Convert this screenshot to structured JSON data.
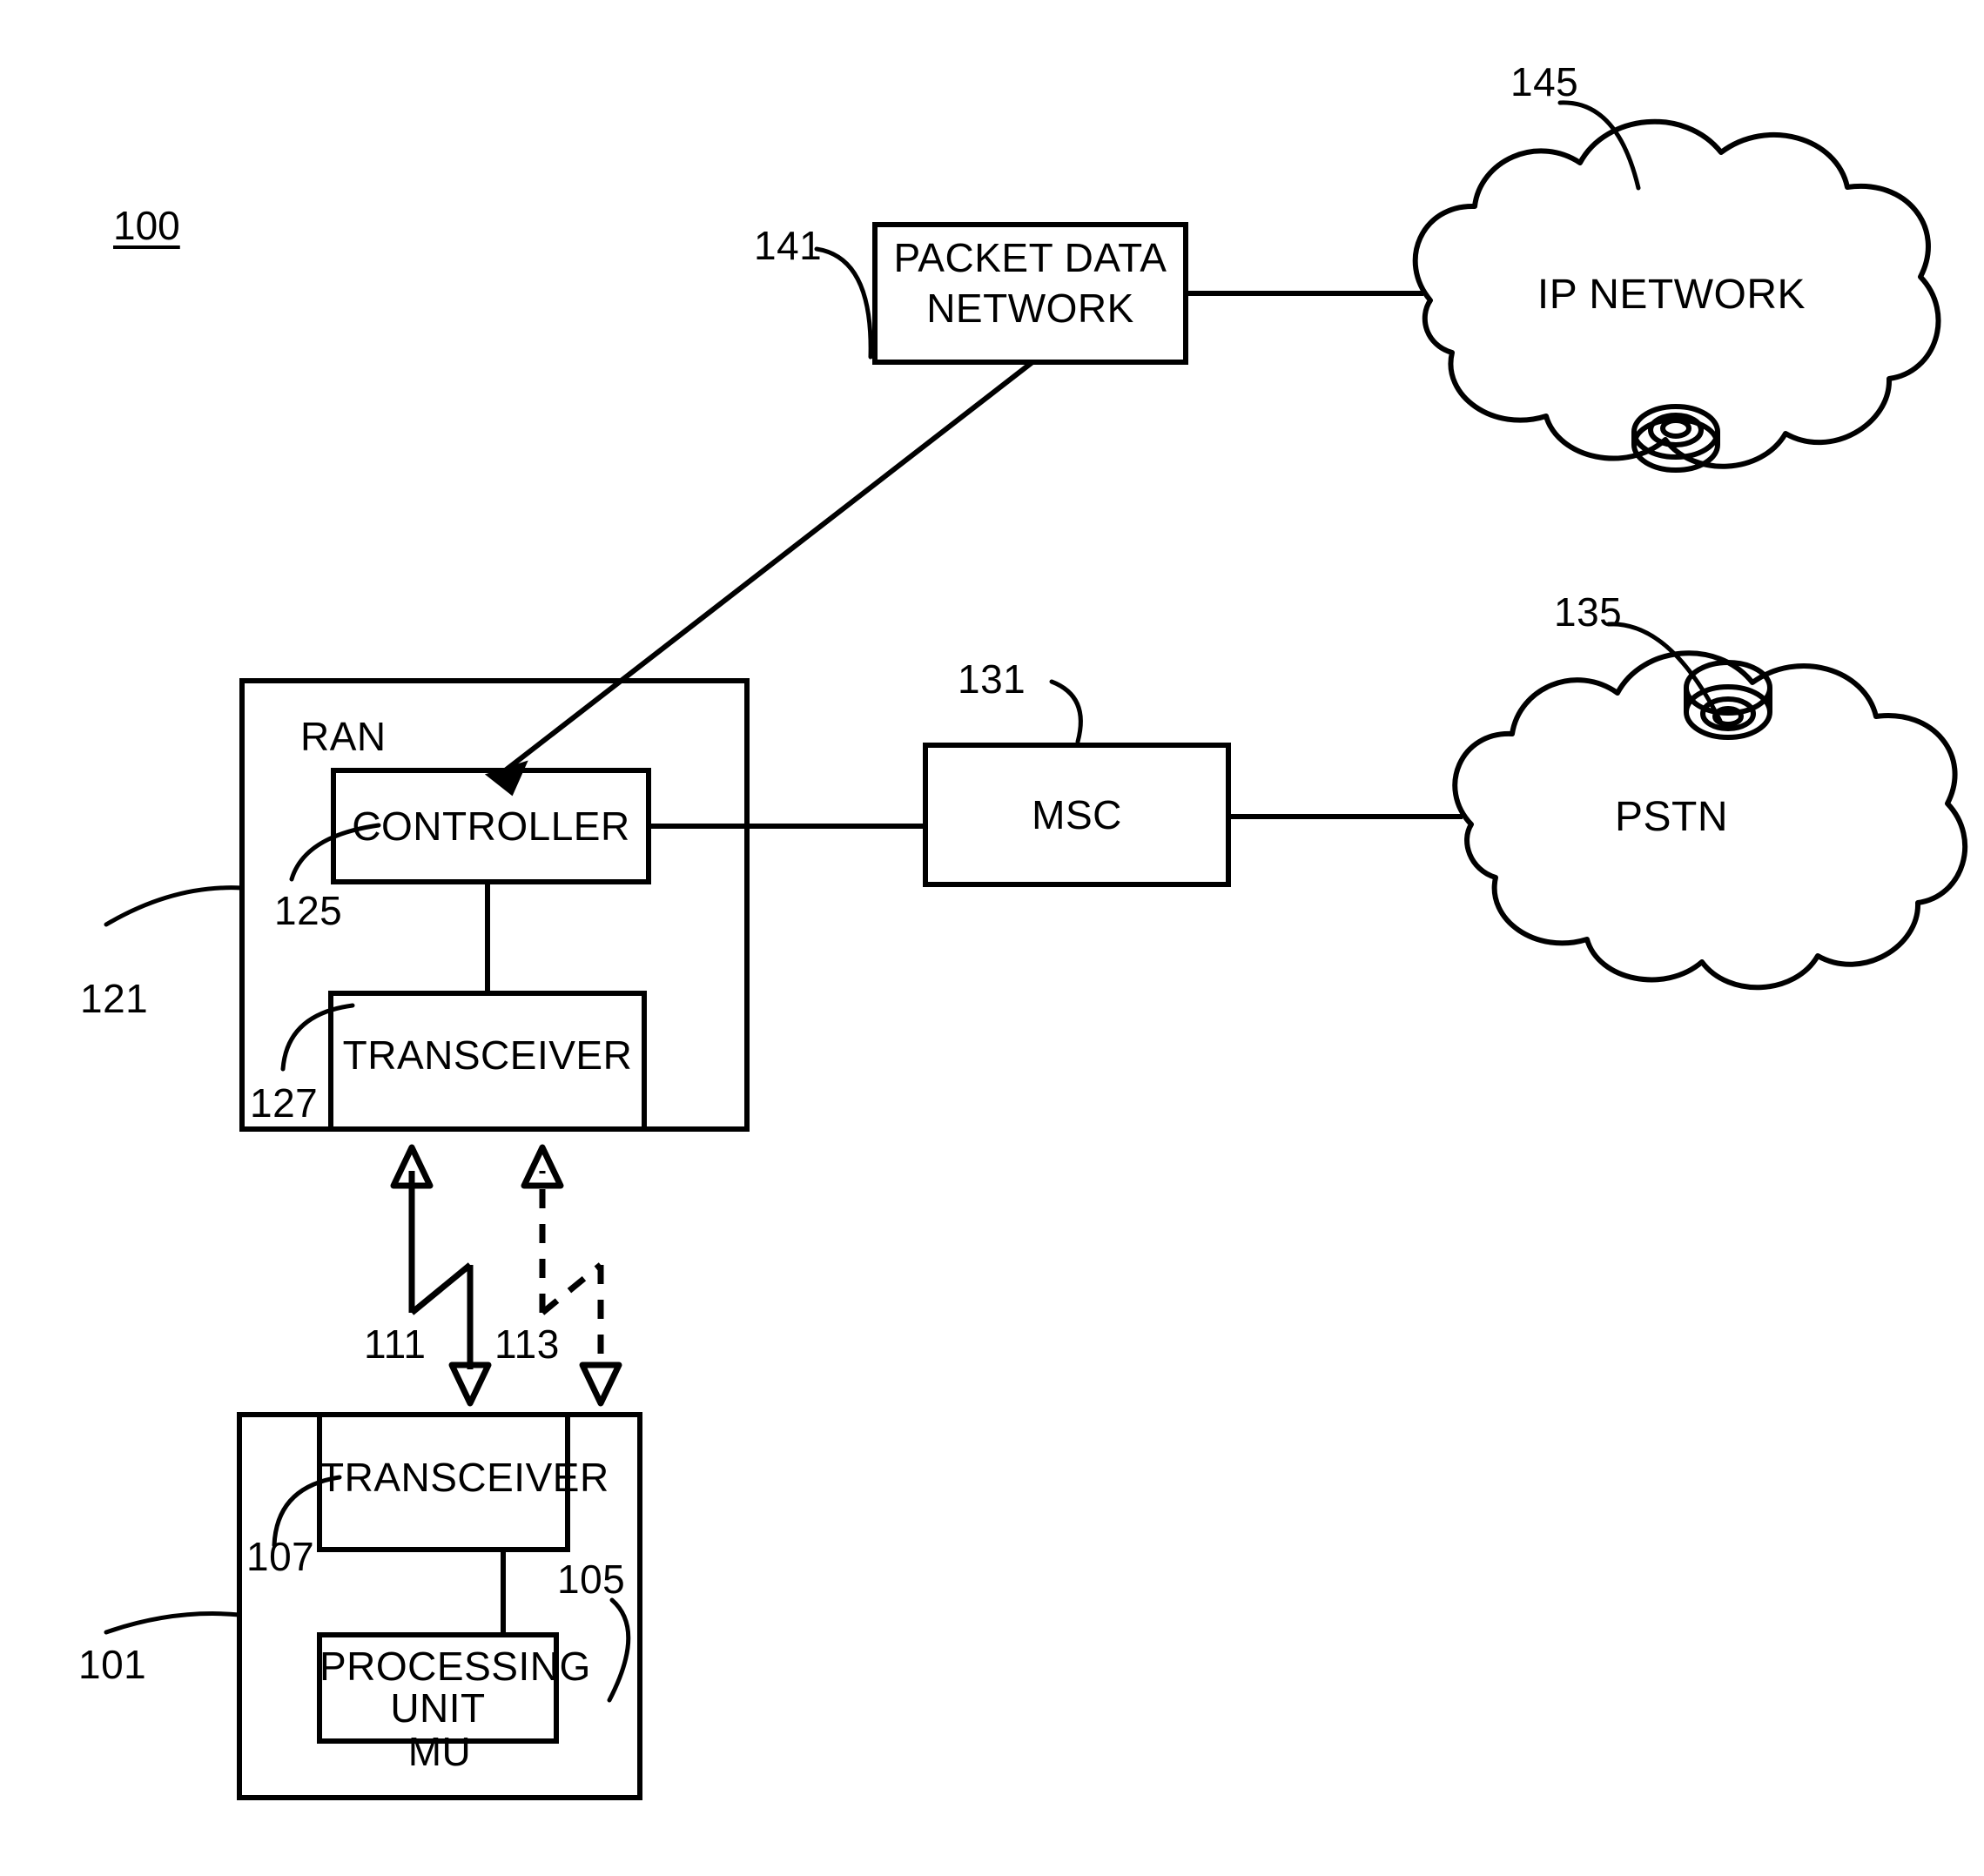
{
  "figure": {
    "number": "100",
    "type": "patent-block-diagram",
    "title_label": "100"
  },
  "blocks": [
    {
      "id": "pdn",
      "label": "PACKET DATA\nNETWORK",
      "ref": "141"
    },
    {
      "id": "controller",
      "label": "CONTROLLER",
      "ref": "125"
    },
    {
      "id": "ran_trx",
      "label": "TRANSCEIVER",
      "ref": "127"
    },
    {
      "id": "ran",
      "label": "RAN",
      "ref": "121"
    },
    {
      "id": "msc",
      "label": "MSC",
      "ref": "131"
    },
    {
      "id": "mu_trx",
      "label": "TRANSCEIVER",
      "ref": "107"
    },
    {
      "id": "proc_unit",
      "label": "PROCESSING\nUNIT",
      "ref": "105"
    },
    {
      "id": "mu",
      "label": "MU",
      "ref": "101"
    }
  ],
  "clouds": [
    {
      "id": "ip_network",
      "label": "IP NETWORK",
      "ref": "145"
    },
    {
      "id": "pstn",
      "label": "PSTN",
      "ref": "135"
    }
  ],
  "links": [
    {
      "id": "uplink",
      "label": "111",
      "style": "solid",
      "desc": "solid lightning-bolt radio link between RAN transceiver and MU transceiver"
    },
    {
      "id": "downlink",
      "label": "113",
      "style": "dashed",
      "desc": "dashed lightning-bolt radio link between RAN transceiver and MU transceiver"
    }
  ],
  "ref_numerals": {
    "fig": "100",
    "mu": "101",
    "processing_unit": "105",
    "mu_transceiver": "107",
    "uplink": "111",
    "downlink": "113",
    "ran": "121",
    "controller": "125",
    "ran_transceiver": "127",
    "msc": "131",
    "pstn": "135",
    "packet_data_network": "141",
    "ip_network": "145"
  },
  "text": {
    "packet_data_network_line1": "PACKET DATA",
    "packet_data_network_line2": "NETWORK",
    "ip_network": "IP NETWORK",
    "ran": "RAN",
    "controller": "CONTROLLER",
    "ran_transceiver": "TRANSCEIVER",
    "msc": "MSC",
    "pstn": "PSTN",
    "mu_transceiver": "TRANSCEIVER",
    "processing_unit_line1": "PROCESSING",
    "processing_unit_line2": "UNIT",
    "mu": "MU"
  },
  "colors": {
    "stroke": "#000000",
    "background": "#ffffff",
    "text": "#000000"
  }
}
